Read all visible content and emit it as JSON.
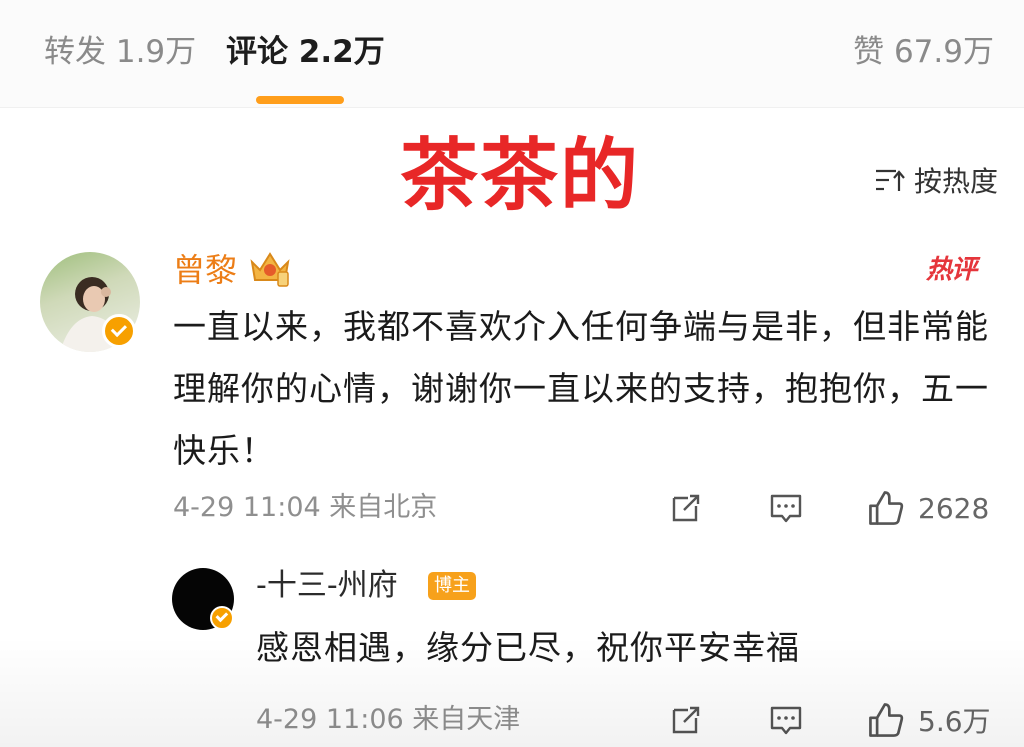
{
  "tabs": {
    "repost": "转发 1.9万",
    "comment": "评论 2.2万",
    "like": "赞 67.9万"
  },
  "overlay_caption": "茶茶的",
  "sort": {
    "label": "按热度",
    "icon": "sort-icon"
  },
  "comments": [
    {
      "author": "曾黎",
      "hot_label": "热评",
      "body": "一直以来，我都不喜欢介入任何争端与是非，但非常能理解你的心情，谢谢你一直以来的支持，抱抱你，五一快乐！",
      "meta": "4-29 11:04  来自北京",
      "likes": "2628",
      "icons": [
        "share-icon",
        "comment-icon",
        "thumbs-up-icon"
      ]
    }
  ],
  "reply": {
    "author": "-十三-州府",
    "badge": "博主",
    "body": "感恩相遇，缘分已尽，祝你平安幸福",
    "meta": "4-29 11:06  来自天津",
    "likes": "5.6万"
  },
  "colors": {
    "accent": "#ff9e1b",
    "author_name": "#ec7d16",
    "overlay_red": "#e82727",
    "hot_red": "#e5353b",
    "verified": "#f7a000"
  }
}
